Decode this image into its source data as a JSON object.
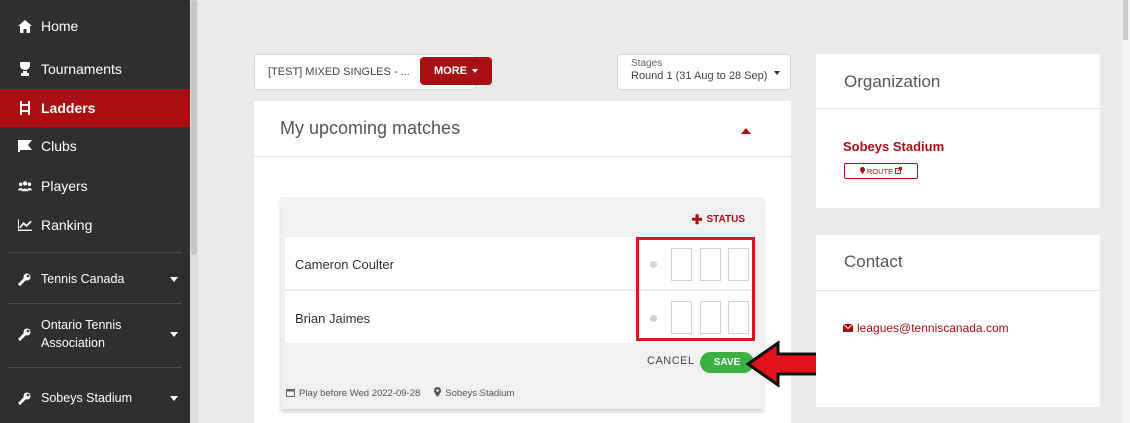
{
  "sidebar": {
    "items": [
      {
        "label": "Home",
        "icon": "home-icon"
      },
      {
        "label": "Tournaments",
        "icon": "trophy-icon"
      },
      {
        "label": "Ladders",
        "icon": "ladder-icon"
      },
      {
        "label": "Clubs",
        "icon": "flag-icon"
      },
      {
        "label": "Players",
        "icon": "users-icon"
      },
      {
        "label": "Ranking",
        "icon": "chart-icon"
      }
    ],
    "groups": [
      {
        "label": "Tennis Canada",
        "icon": "wrench-icon"
      },
      {
        "label_line1": "Ontario Tennis",
        "label_line2": "Association",
        "icon": "wrench-icon"
      },
      {
        "label": "Sobeys Stadium",
        "icon": "wrench-icon"
      }
    ]
  },
  "toolbar": {
    "ladder_select": "[TEST] MIXED SINGLES - ...",
    "more_label": "MORE",
    "stages_label": "Stages",
    "stages_value": "Round 1 (31 Aug to 28 Sep)"
  },
  "matches": {
    "title": "My upcoming matches",
    "status_label": "STATUS",
    "players": [
      "Cameron Coulter",
      "Brian Jaimes"
    ],
    "cancel_label": "CANCEL",
    "save_label": "SAVE",
    "deadline": "Play before Wed 2022-09-28",
    "venue": "Sobeys Stadium"
  },
  "organization": {
    "title": "Organization",
    "name": "Sobeys Stadium",
    "route_label": "ROUTE"
  },
  "contact": {
    "title": "Contact",
    "email": "leagues@tenniscanada.com"
  },
  "colors": {
    "brand_red": "#a80e12",
    "sidebar_bg": "#2f2f2f",
    "save_green": "#3cb043",
    "highlight_red": "#e0121b"
  }
}
